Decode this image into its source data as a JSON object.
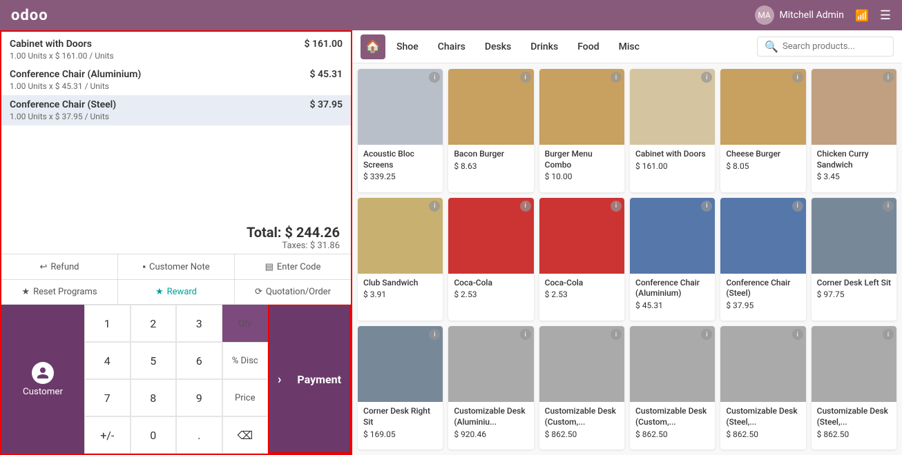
{
  "topbar": {
    "logo": "odoo",
    "user": "Mitchell Admin",
    "wifi_icon": "wifi",
    "menu_icon": "hamburger"
  },
  "order": {
    "items": [
      {
        "name": "Cabinet with Doors",
        "quantity": "1.00",
        "unit_price": "161.00",
        "unit": "Units",
        "total": "$ 161.00"
      },
      {
        "name": "Conference Chair (Aluminium)",
        "quantity": "1.00",
        "unit_price": "45.31",
        "unit": "Units",
        "total": "$ 45.31"
      },
      {
        "name": "Conference Chair (Steel)",
        "quantity": "1.00",
        "unit_price": "37.95",
        "unit": "Units",
        "total": "$ 37.95"
      }
    ],
    "total_label": "Total: $ 244.26",
    "taxes_label": "Taxes: $ 31.86"
  },
  "action_buttons": [
    {
      "id": "refund",
      "label": "Refund",
      "icon": "↩"
    },
    {
      "id": "customer-note",
      "label": "Customer Note",
      "icon": "▪"
    },
    {
      "id": "enter-code",
      "label": "Enter Code",
      "icon": "▤"
    },
    {
      "id": "reset-programs",
      "label": "Reset Programs",
      "icon": "★"
    },
    {
      "id": "reward",
      "label": "Reward",
      "icon": "★"
    },
    {
      "id": "quotation-order",
      "label": "Quotation/Order",
      "icon": "⟳"
    }
  ],
  "numpad": {
    "buttons": [
      "1",
      "2",
      "3",
      "4",
      "5",
      "6",
      "7",
      "8",
      "9",
      "+/-",
      "0",
      "."
    ],
    "function_buttons": [
      "Qty",
      "% Disc",
      "Price",
      "⌫"
    ]
  },
  "customer": {
    "label": "Customer"
  },
  "payment": {
    "label": "Payment"
  },
  "categories": {
    "home": "🏠",
    "items": [
      "Shoe",
      "Chairs",
      "Desks",
      "Drinks",
      "Food",
      "Misc"
    ]
  },
  "search": {
    "placeholder": "Search products..."
  },
  "products": [
    {
      "name": "Acoustic Bloc Screens",
      "price": "$ 339.25",
      "img_color": "img-gray"
    },
    {
      "name": "Bacon Burger",
      "price": "$ 8.63",
      "img_color": "img-brown"
    },
    {
      "name": "Burger Menu Combo",
      "price": "$ 10.00",
      "img_color": "img-brown"
    },
    {
      "name": "Cabinet with Doors",
      "price": "$ 161.00",
      "img_color": "img-beige"
    },
    {
      "name": "Cheese Burger",
      "price": "$ 8.05",
      "img_color": "img-brown"
    },
    {
      "name": "Chicken Curry Sandwich",
      "price": "$ 3.45",
      "img_color": "img-brown"
    },
    {
      "name": "Club Sandwich",
      "price": "$ 3.91",
      "img_color": "img-brown"
    },
    {
      "name": "Coca-Cola",
      "price": "$ 2.53",
      "img_color": "img-red"
    },
    {
      "name": "Coca-Cola",
      "price": "$ 2.53",
      "img_color": "img-red"
    },
    {
      "name": "Conference Chair (Aluminium)",
      "price": "$ 45.31",
      "img_color": "img-teal"
    },
    {
      "name": "Conference Chair (Steel)",
      "price": "$ 37.95",
      "img_color": "img-teal"
    },
    {
      "name": "Corner Desk Left Sit",
      "price": "$ 97.75",
      "img_color": "img-dark"
    },
    {
      "name": "Corner Desk Right Sit",
      "price": "$ 169.05",
      "img_color": "img-dark"
    },
    {
      "name": "Customizable Desk (Aluminiu...",
      "price": "$ 920.46",
      "img_color": "img-gray"
    },
    {
      "name": "Customizable Desk (Custom,...",
      "price": "$ 862.50",
      "img_color": "img-gray"
    },
    {
      "name": "Customizable Desk (Custom,...",
      "price": "$ 862.50",
      "img_color": "img-gray"
    },
    {
      "name": "Customizable Desk (Steel,...",
      "price": "$ 862.50",
      "img_color": "img-gray"
    },
    {
      "name": "Customizable Desk (Steel,...",
      "price": "$ 862.50",
      "img_color": "img-gray"
    }
  ]
}
